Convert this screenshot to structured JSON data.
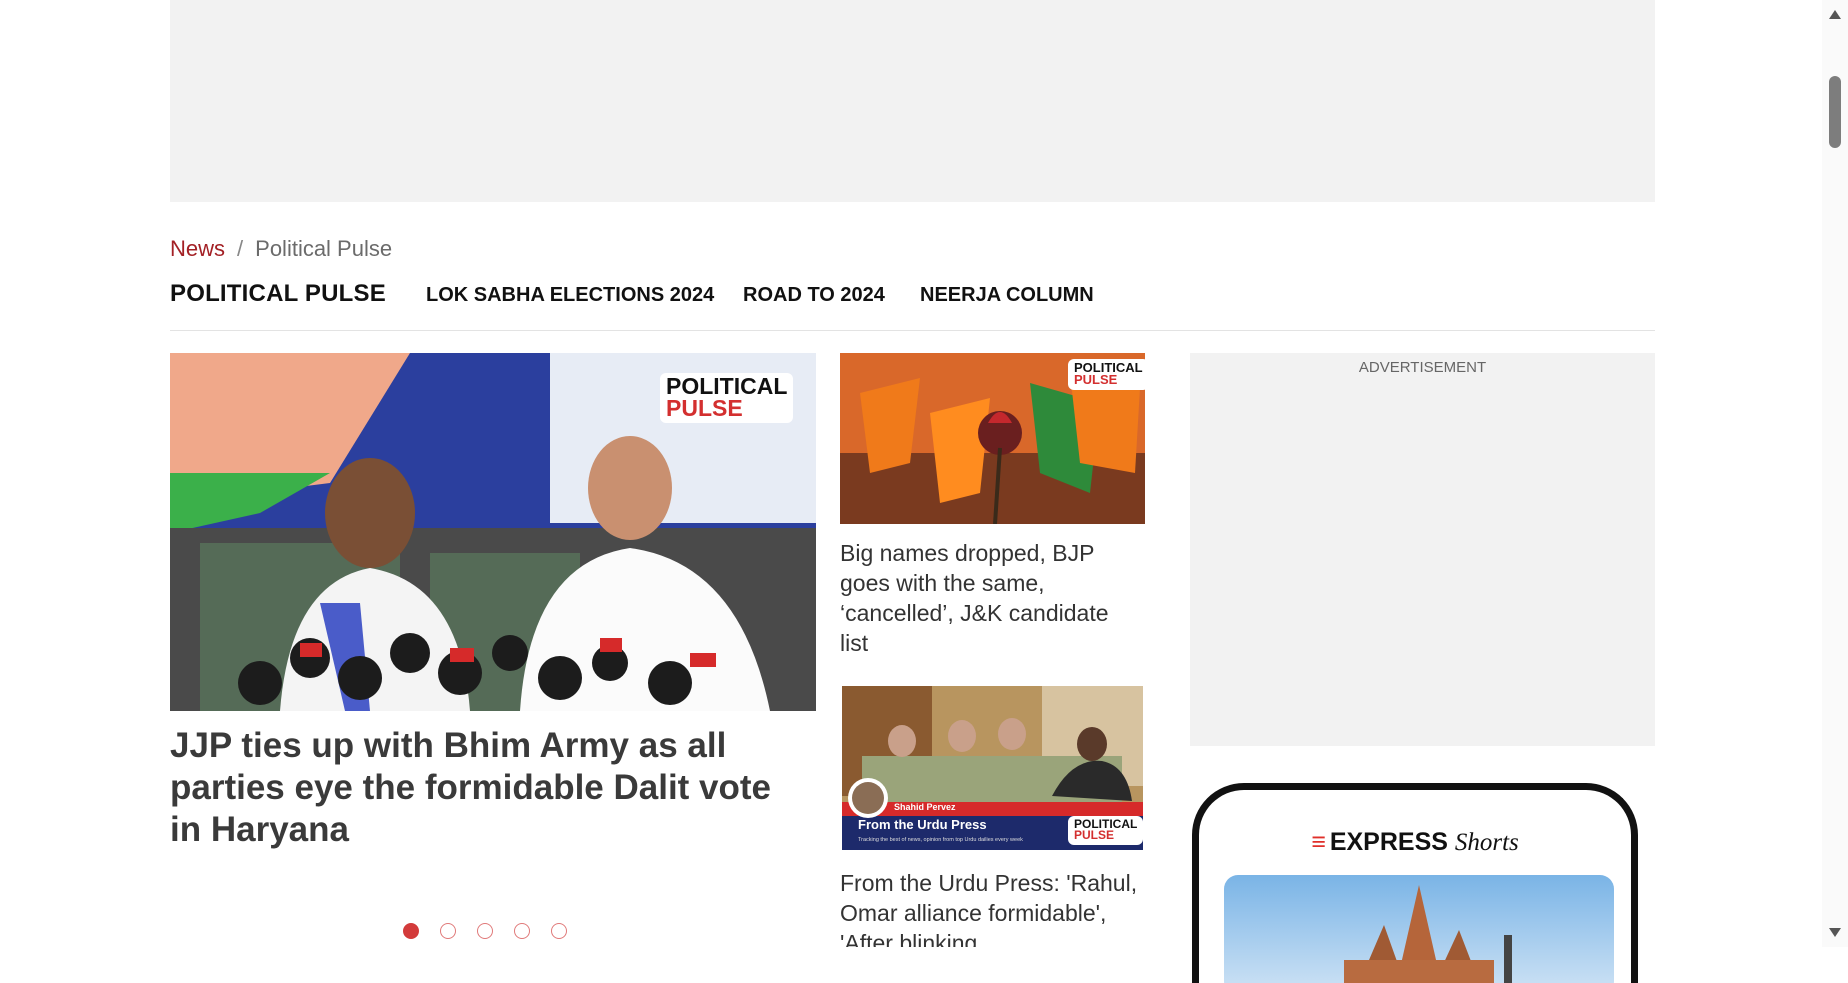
{
  "breadcrumb": {
    "home": "News",
    "separator": "/",
    "current": "Political Pulse"
  },
  "subnav": {
    "section_title": "POLITICAL PULSE",
    "items": [
      "LOK SABHA ELECTIONS 2024",
      "ROAD TO 2024",
      "NEERJA COLUMN"
    ]
  },
  "hero": {
    "badge_line1": "POLITICAL",
    "badge_line2": "PULSE",
    "title": "JJP ties up with Bhim Army as all parties eye the formidable Dalit vote in Haryana"
  },
  "carousel": {
    "count": 5,
    "active_index": 0
  },
  "cards": [
    {
      "badge_line1": "POLITICAL",
      "badge_line2": "PULSE",
      "title": "Big names dropped, BJP goes with the same, ‘cancelled’, J&K candidate list"
    },
    {
      "badge_line1": "POLITICAL",
      "badge_line2": "PULSE",
      "author": "Shahid Pervez",
      "banner": "From the Urdu Press",
      "banner_sub": "Tracking the best of news, opinion from top Urdu dailies every week",
      "title": "From the Urdu Press: 'Rahul, Omar alliance formidable', 'After blinking"
    }
  ],
  "sidebar": {
    "ad_label": "ADVERTISEMENT",
    "shorts_brand": "EXPRESS",
    "shorts_suffix": "Shorts"
  },
  "colors": {
    "accent": "#a32025",
    "dot_active": "#d33b3b",
    "ad_bg": "#f2f2f2"
  },
  "icons": [
    "express-logo-icon",
    "scroll-up-icon",
    "scroll-down-icon"
  ]
}
